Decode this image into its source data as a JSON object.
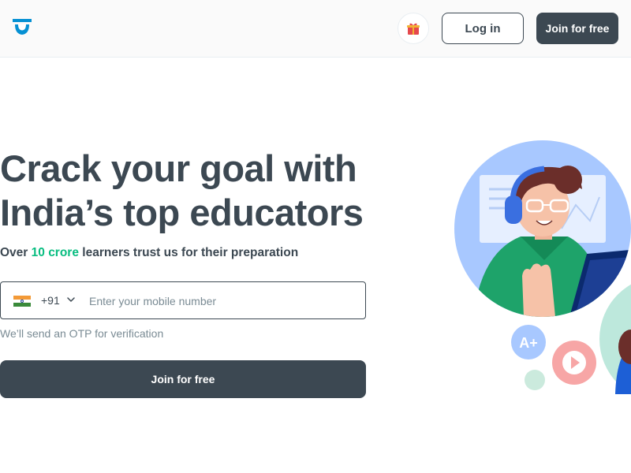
{
  "header": {
    "logo_icon": "unacademy-logo-icon",
    "gift_icon": "gift-icon",
    "login_label": "Log in",
    "join_label": "Join for free"
  },
  "hero": {
    "title_line1": "Crack your goal with",
    "title_line2": "India’s top educators",
    "subtitle_prefix": "Over ",
    "subtitle_accent": "10 crore",
    "subtitle_suffix": " learners trust us for their preparation",
    "accent_color": "#08bd80"
  },
  "phone": {
    "flag_icon": "india-flag-icon",
    "country_code": "+91",
    "chevron_icon": "chevron-down-icon",
    "placeholder": "Enter your mobile number",
    "value": ""
  },
  "otp_note": "We’ll send an OTP for verification",
  "cta": {
    "join_label": "Join for free"
  },
  "colors": {
    "primary_dark": "#3c4852",
    "accent_green": "#08bd80",
    "logo_blue": "#0590d3"
  }
}
